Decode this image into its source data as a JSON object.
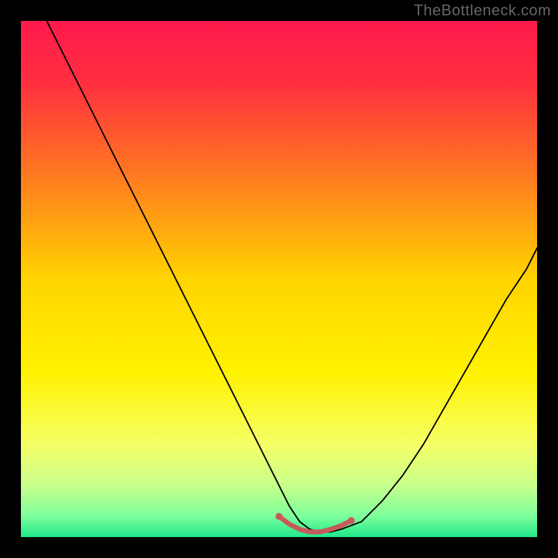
{
  "watermark": "TheBottleneck.com",
  "chart_data": {
    "type": "line",
    "title": "",
    "xlabel": "",
    "ylabel": "",
    "xlim": [
      0,
      100
    ],
    "ylim": [
      0,
      100
    ],
    "background_gradient": {
      "stops": [
        {
          "pos": 0.0,
          "color": "#ff1a4d"
        },
        {
          "pos": 0.12,
          "color": "#ff2f3f"
        },
        {
          "pos": 0.3,
          "color": "#ff7a20"
        },
        {
          "pos": 0.5,
          "color": "#ffd400"
        },
        {
          "pos": 0.68,
          "color": "#fff200"
        },
        {
          "pos": 0.82,
          "color": "#f6ff66"
        },
        {
          "pos": 0.9,
          "color": "#c8ff8c"
        },
        {
          "pos": 0.96,
          "color": "#7bff9c"
        },
        {
          "pos": 1.0,
          "color": "#20e88a"
        }
      ]
    },
    "series": [
      {
        "name": "bottleneck-curve",
        "color": "#000000",
        "width": 2,
        "x": [
          5,
          8,
          12,
          16,
          20,
          24,
          28,
          32,
          36,
          40,
          44,
          48,
          50,
          52,
          54,
          56,
          58,
          60,
          62,
          66,
          70,
          74,
          78,
          82,
          86,
          90,
          94,
          98,
          100
        ],
        "y": [
          100,
          94,
          86,
          78,
          70,
          62,
          54,
          46,
          38,
          30,
          22,
          14,
          10,
          6,
          3,
          1.5,
          1,
          1,
          1.5,
          3,
          7,
          12,
          18,
          25,
          32,
          39,
          46,
          52,
          56
        ]
      },
      {
        "name": "highlight-band",
        "color": "#c65a5a",
        "width": 7,
        "x": [
          50,
          52,
          54,
          56,
          58,
          60,
          62,
          64
        ],
        "y": [
          4,
          2.5,
          1.5,
          1,
          1,
          1.5,
          2.2,
          3.2
        ]
      }
    ],
    "highlight_dots": {
      "color": "#c65a5a",
      "radius": 5,
      "points": [
        {
          "x": 50,
          "y": 4
        },
        {
          "x": 64,
          "y": 3.2
        }
      ]
    }
  }
}
